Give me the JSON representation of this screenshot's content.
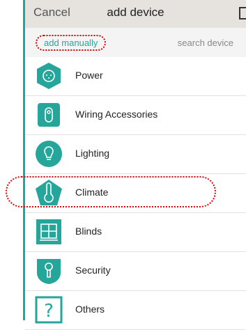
{
  "header": {
    "cancel_label": "Cancel",
    "title": "add device"
  },
  "tabs": {
    "manual_label": "add manually",
    "search_label": "search device"
  },
  "items": [
    {
      "label": "Power",
      "icon": "power-outlet-icon"
    },
    {
      "label": "Wiring Accessories",
      "icon": "switch-icon"
    },
    {
      "label": "Lighting",
      "icon": "bulb-icon"
    },
    {
      "label": "Climate",
      "icon": "thermometer-icon"
    },
    {
      "label": "Blinds",
      "icon": "window-blinds-icon"
    },
    {
      "label": "Security",
      "icon": "lock-icon"
    },
    {
      "label": "Others",
      "icon": "question-icon"
    }
  ],
  "colors": {
    "accent": "#26a69a",
    "highlight": "#dd0000"
  }
}
